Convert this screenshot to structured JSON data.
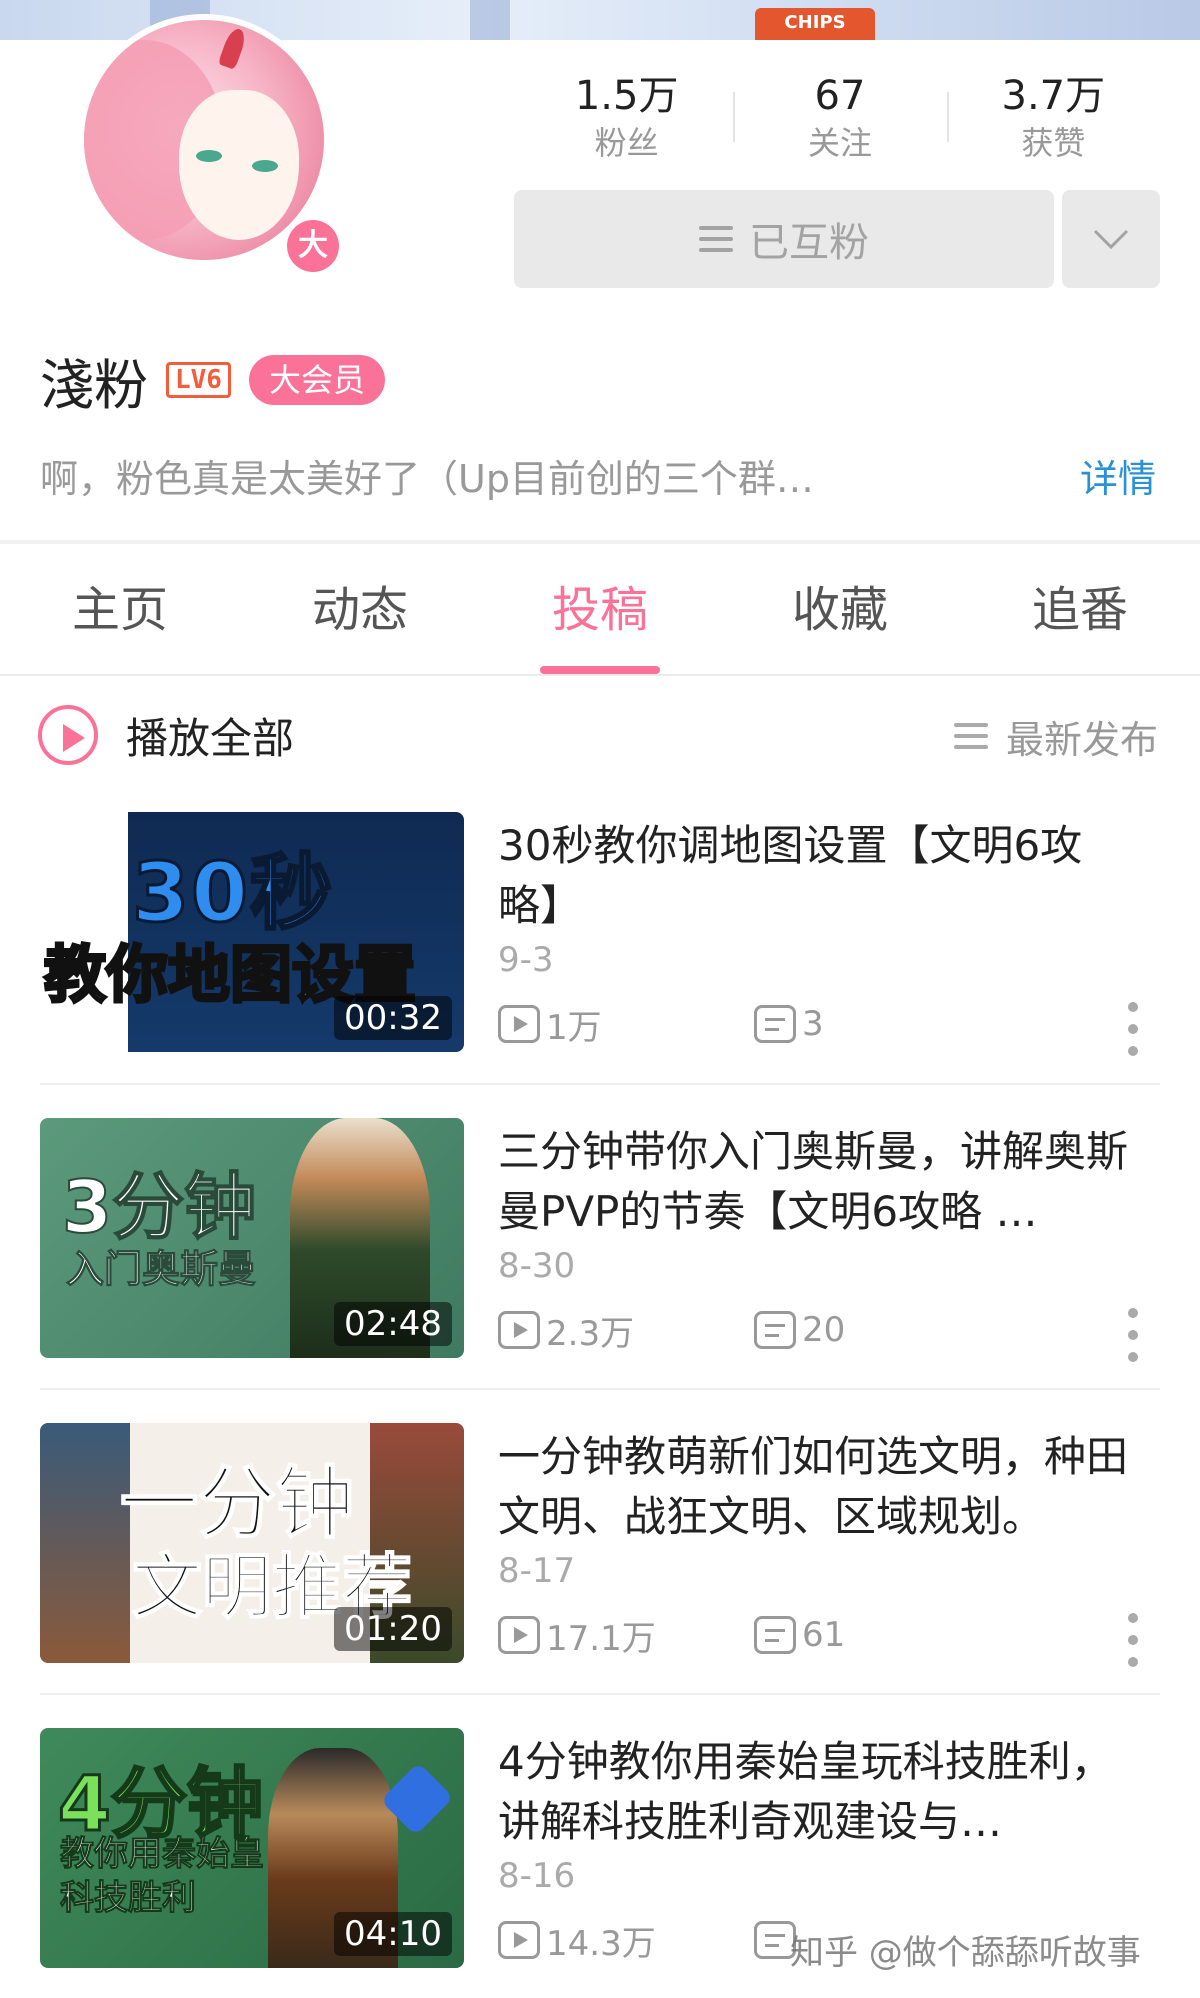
{
  "profile": {
    "badge": "大",
    "stats": [
      {
        "value": "1.5万",
        "label": "粉丝"
      },
      {
        "value": "67",
        "label": "关注"
      },
      {
        "value": "3.7万",
        "label": "获赞"
      }
    ],
    "follow_status": "已互粉",
    "name": "淺粉",
    "level": "LV6",
    "vip": "大会员",
    "bio": "啊，粉色真是太美好了（Up目前创的三个群…",
    "detail": "详情"
  },
  "banner": {
    "chips": "CHIPS"
  },
  "tabs": [
    {
      "label": "主页",
      "active": false
    },
    {
      "label": "动态",
      "active": false
    },
    {
      "label": "投稿",
      "active": true
    },
    {
      "label": "收藏",
      "active": false
    },
    {
      "label": "追番",
      "active": false
    }
  ],
  "list_header": {
    "play_all": "播放全部",
    "sort": "最新发布"
  },
  "videos": [
    {
      "thumb_line1": "30秒",
      "thumb_line2": "教你地图设置",
      "duration": "00:32",
      "title": "30秒教你调地图设置【文明6攻略】",
      "date": "9-3",
      "views": "1万",
      "comments": "3"
    },
    {
      "thumb_line1": "3分钟",
      "thumb_line2": "入门奥斯曼",
      "duration": "02:48",
      "title": "三分钟带你入门奥斯曼，讲解奥斯曼PVP的节奏【文明6攻略 …",
      "date": "8-30",
      "views": "2.3万",
      "comments": "20"
    },
    {
      "thumb_line1": "一分钟",
      "thumb_line2": "文明推荐",
      "duration": "01:20",
      "title": "一分钟教萌新们如何选文明，种田文明、战狂文明、区域规划。",
      "date": "8-17",
      "views": "17.1万",
      "comments": "61"
    },
    {
      "thumb_line1": "4分钟",
      "thumb_line2": "教你用秦始皇科技胜利",
      "duration": "04:10",
      "title": "4分钟教你用秦始皇玩科技胜利，讲解科技胜利奇观建设与…",
      "date": "8-16",
      "views": "14.3万",
      "comments": ""
    }
  ],
  "watermark": "知乎 @做个舔舔听故事",
  "colors": {
    "accent": "#fb7299",
    "link": "#2a92d4",
    "level": "#f25d3c"
  }
}
